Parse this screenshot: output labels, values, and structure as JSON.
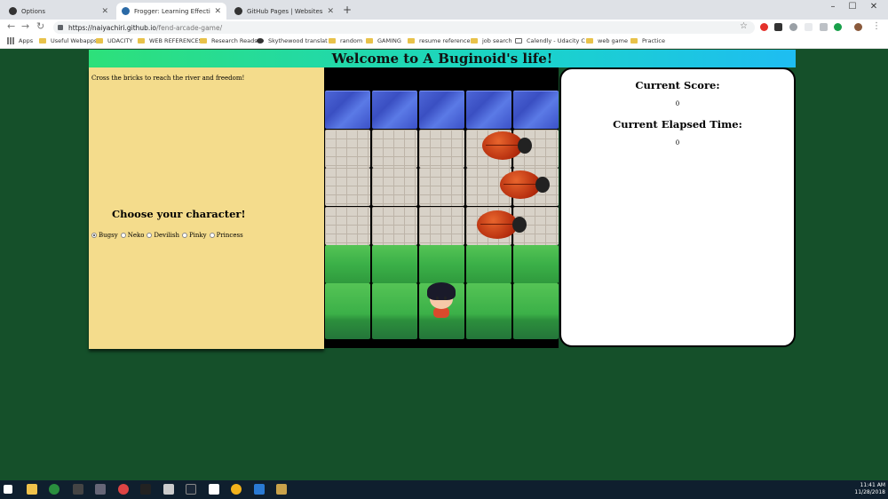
{
  "browser": {
    "tabs": [
      {
        "title": "Options",
        "active": false
      },
      {
        "title": "Frogger: Learning Effective Javas",
        "active": true
      },
      {
        "title": "GitHub Pages | Websites for you",
        "active": false
      }
    ],
    "url_host": "https://naiyachiri.github.io",
    "url_path": "/fend-arcade-game/",
    "bookmarks": [
      "Apps",
      "Useful Webapps",
      "UDACITY",
      "WEB REFERENCES",
      "Research Reads",
      "Skythewood translat",
      "random",
      "GAMING",
      "resume references",
      "job search",
      "Calendly - Udacity C",
      "web game",
      "Practice"
    ]
  },
  "page": {
    "banner_title": "Welcome to A Buginoid's life!",
    "instructions": "Cross the bricks to reach the river and freedom!",
    "choose_title": "Choose your character!",
    "characters": [
      "Bugsy",
      "Neko",
      "Devilish",
      "Pinky",
      "Princess"
    ],
    "selected_character": "Bugsy",
    "score_label": "Current Score:",
    "score_value": "0",
    "time_label": "Current Elapsed Time:",
    "time_value": "0"
  },
  "taskbar": {
    "time": "11:41 AM",
    "date": "11/28/2018"
  },
  "colors": {
    "page_bg": "#15502a",
    "left_panel": "#f4dc8c",
    "banner_start": "#2de07a",
    "banner_end": "#1ebdf2"
  }
}
